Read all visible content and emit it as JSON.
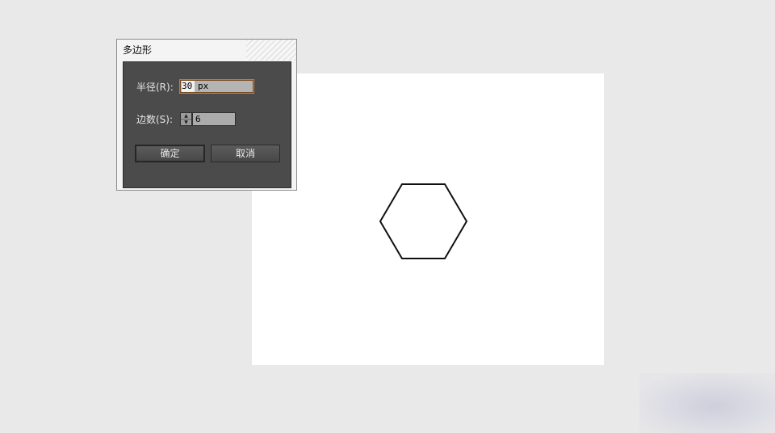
{
  "dialog": {
    "title": "多边形",
    "radius_label": "半径(R):",
    "radius_value": "30",
    "radius_unit": "px",
    "sides_label": "边数(S):",
    "sides_value": "6",
    "ok_label": "确定",
    "cancel_label": "取消"
  },
  "canvas": {
    "shape": "hexagon",
    "sides": 6,
    "radius_px": 30,
    "stroke_color": "#111111",
    "fill_color": "#ffffff"
  },
  "icons": {
    "stepper_up": "chevron-up-icon",
    "stepper_down": "chevron-down-icon"
  },
  "colors": {
    "workspace": "#e9e9e9",
    "dialog_body": "#4b4b4b",
    "focus_border": "#d07a2a"
  }
}
